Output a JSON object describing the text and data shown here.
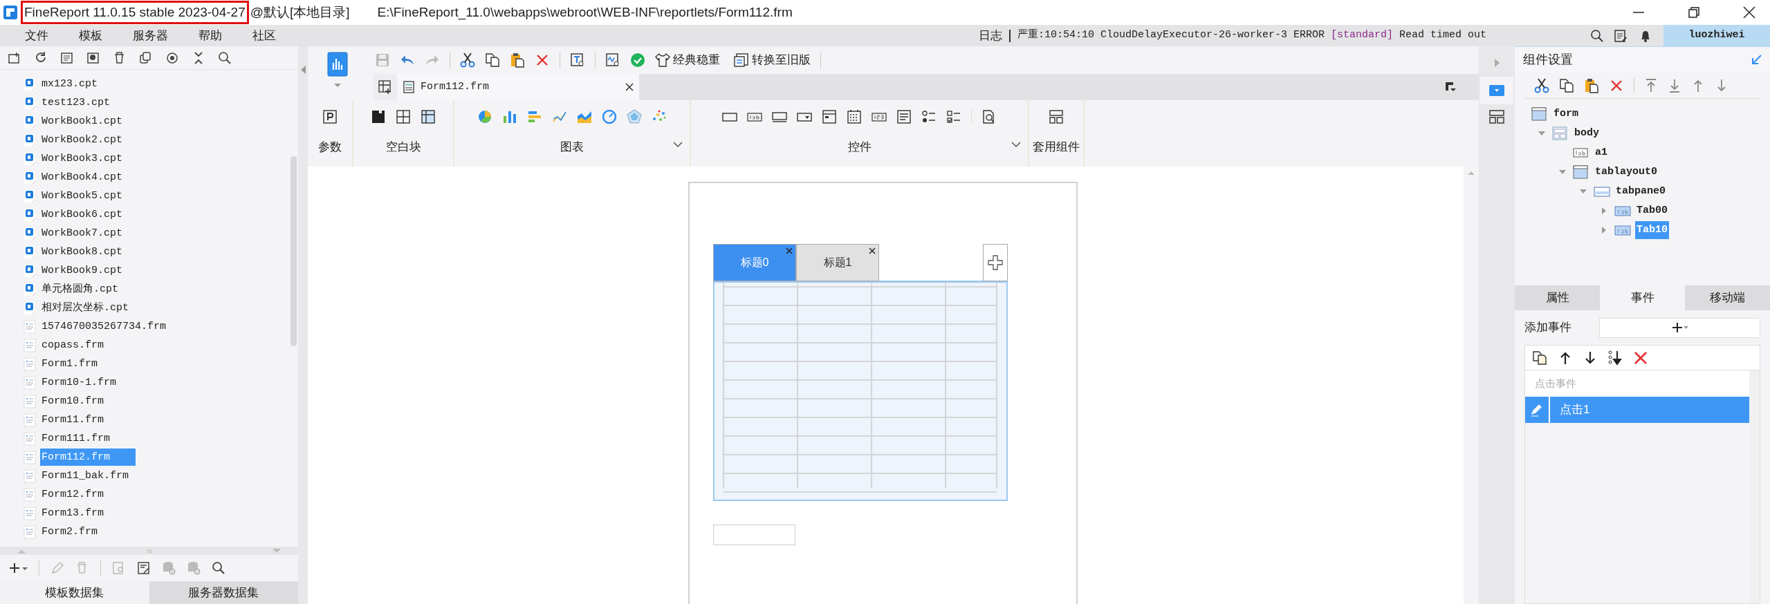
{
  "title": {
    "app": "FineReport 11.0.15 stable 2023-04-27",
    "workspace": "@默认[本地目录]",
    "path": "E:\\FineReport_11.0\\webapps\\webroot\\WEB-INF\\reportlets/Form112.frm",
    "highlighted": true
  },
  "menus": [
    "文件",
    "模板",
    "服务器",
    "帮助",
    "社区"
  ],
  "log": {
    "label": "日志",
    "message": "严重:10:54:10 CloudDelayExecutor-26-worker-3 ERROR",
    "tag": "[standard]",
    "detail": "Read timed out"
  },
  "user": "luozhiwei",
  "file_tree": [
    {
      "name": "mx123.cpt",
      "kind": "cpt",
      "selected": false
    },
    {
      "name": "test123.cpt",
      "kind": "cpt",
      "selected": false
    },
    {
      "name": "WorkBook1.cpt",
      "kind": "cpt",
      "selected": false
    },
    {
      "name": "WorkBook2.cpt",
      "kind": "cpt",
      "selected": false
    },
    {
      "name": "WorkBook3.cpt",
      "kind": "cpt",
      "selected": false
    },
    {
      "name": "WorkBook4.cpt",
      "kind": "cpt",
      "selected": false
    },
    {
      "name": "WorkBook5.cpt",
      "kind": "cpt",
      "selected": false
    },
    {
      "name": "WorkBook6.cpt",
      "kind": "cpt",
      "selected": false
    },
    {
      "name": "WorkBook7.cpt",
      "kind": "cpt",
      "selected": false
    },
    {
      "name": "WorkBook8.cpt",
      "kind": "cpt",
      "selected": false
    },
    {
      "name": "WorkBook9.cpt",
      "kind": "cpt",
      "selected": false
    },
    {
      "name": "单元格圆角.cpt",
      "kind": "cpt",
      "selected": false
    },
    {
      "name": "相对层次坐标.cpt",
      "kind": "cpt",
      "selected": false
    },
    {
      "name": "1574670035267734.frm",
      "kind": "frm",
      "selected": false
    },
    {
      "name": "copass.frm",
      "kind": "frm",
      "selected": false
    },
    {
      "name": "Form1.frm",
      "kind": "frm",
      "selected": false
    },
    {
      "name": "Form10-1.frm",
      "kind": "frm",
      "selected": false
    },
    {
      "name": "Form10.frm",
      "kind": "frm",
      "selected": false
    },
    {
      "name": "Form11.frm",
      "kind": "frm",
      "selected": false
    },
    {
      "name": "Form111.frm",
      "kind": "frm",
      "selected": false
    },
    {
      "name": "Form112.frm",
      "kind": "frm",
      "selected": true
    },
    {
      "name": "Form11_bak.frm",
      "kind": "frm",
      "selected": false
    },
    {
      "name": "Form12.frm",
      "kind": "frm",
      "selected": false
    },
    {
      "name": "Form13.frm",
      "kind": "frm",
      "selected": false
    },
    {
      "name": "Form2.frm",
      "kind": "frm",
      "selected": false
    }
  ],
  "dataset_tabs": [
    {
      "label": "模板数据集",
      "selected": true
    },
    {
      "label": "服务器数据集",
      "selected": false
    }
  ],
  "toolbar_buttons": [
    "经典稳重",
    "转换至旧版"
  ],
  "document_tab": {
    "label": "Form112.frm",
    "selected": true
  },
  "ribbon_groups": [
    {
      "label": "参数",
      "kind": "param",
      "has_menu": false
    },
    {
      "label": "空白块",
      "kind": "blank",
      "has_menu": false
    },
    {
      "label": "图表",
      "kind": "chart",
      "has_menu": true
    },
    {
      "label": "控件",
      "kind": "widget",
      "has_menu": true
    },
    {
      "label": "套用组件",
      "kind": "template",
      "has_menu": false
    }
  ],
  "canvas": {
    "tabs": [
      {
        "label": "标题0",
        "selected": true
      },
      {
        "label": "标题1",
        "selected": false
      }
    ]
  },
  "component_settings": {
    "title": "组件设置",
    "tree": [
      {
        "label": "form",
        "kind": "form",
        "selected": false,
        "children": [
          {
            "label": "body",
            "kind": "body",
            "expanded": true,
            "selected": false,
            "children": [
              {
                "label": "a1",
                "kind": "label",
                "selected": false
              },
              {
                "label": "tablayout0",
                "kind": "tablayout",
                "expanded": true,
                "selected": false,
                "children": [
                  {
                    "label": "tabpane0",
                    "kind": "tabpane",
                    "expanded": true,
                    "selected": false,
                    "children": [
                      {
                        "label": "Tab00",
                        "kind": "tab",
                        "expanded": false,
                        "selected": false
                      },
                      {
                        "label": "Tab10",
                        "kind": "tab",
                        "expanded": false,
                        "selected": true
                      }
                    ]
                  }
                ]
              }
            ]
          }
        ]
      }
    ],
    "tabs": [
      {
        "label": "属性",
        "selected": false
      },
      {
        "label": "事件",
        "selected": true
      },
      {
        "label": "移动端",
        "selected": false
      }
    ],
    "add_event_label": "添加事件",
    "event_group": "点击事件",
    "events": [
      {
        "label": "点击1",
        "selected": true
      }
    ]
  }
}
